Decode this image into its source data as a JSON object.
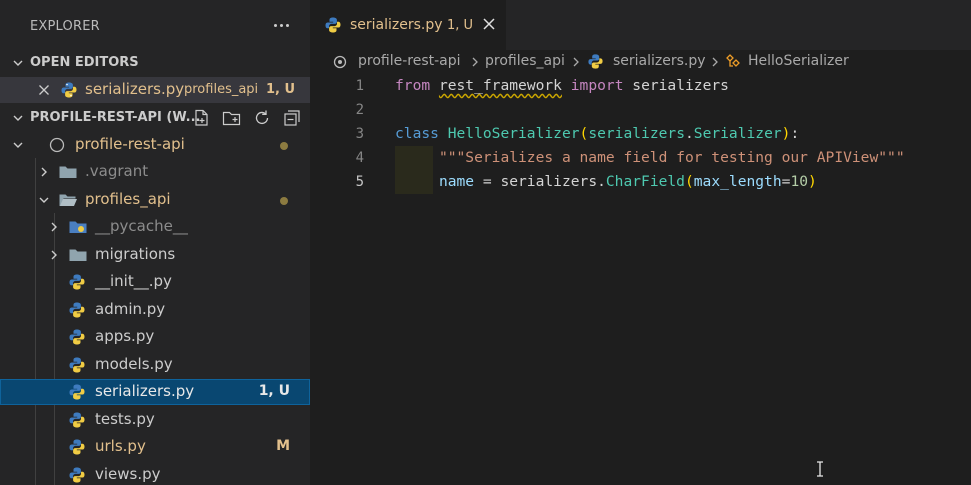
{
  "sidebar": {
    "title": "EXPLORER",
    "open_editors": {
      "title": "OPEN EDITORS",
      "items": [
        {
          "name": "serializers.py",
          "folder": "profiles_api",
          "status": "1, U"
        }
      ]
    },
    "workspace": {
      "title": "PROFILE-REST-API (W...",
      "tree": [
        {
          "label": "profile-rest-api",
          "status": "dot"
        },
        {
          "label": ".vagrant"
        },
        {
          "label": "profiles_api",
          "status": "dot"
        },
        {
          "label": "__pycache__"
        },
        {
          "label": "migrations"
        },
        {
          "label": "__init__.py"
        },
        {
          "label": "admin.py"
        },
        {
          "label": "apps.py"
        },
        {
          "label": "models.py"
        },
        {
          "label": "serializers.py",
          "status": "1, U"
        },
        {
          "label": "tests.py"
        },
        {
          "label": "urls.py",
          "status": "M"
        },
        {
          "label": "views.py"
        }
      ]
    }
  },
  "editor": {
    "tab": {
      "label": "serializers.py",
      "status": "1, U"
    },
    "breadcrumbs": [
      "profile-rest-api",
      "profiles_api",
      "serializers.py",
      "HelloSerializer"
    ],
    "line_numbers": [
      "1",
      "2",
      "3",
      "4",
      "5"
    ],
    "code": {
      "l1": {
        "from": "from",
        "module": "rest_framework",
        "import": "import",
        "name": "serializers"
      },
      "l3": {
        "class": "class",
        "cls": "HelloSerializer",
        "open": "(",
        "mod": "serializers",
        "dot": ".",
        "base": "Serializer",
        "close": ")",
        "colon": ":"
      },
      "l4": {
        "doc": "\"\"\"Serializes a name field for testing our APIView\"\"\""
      },
      "l5": {
        "var": "name",
        "eq": " = serializers.",
        "func": "CharField",
        "open": "(",
        "kw": "max_length",
        "assign": "=",
        "num": "10",
        "close": ")"
      }
    }
  },
  "colors": {
    "untracked": "#73c991",
    "modified": "#e2c08d",
    "selection": "#094771"
  }
}
